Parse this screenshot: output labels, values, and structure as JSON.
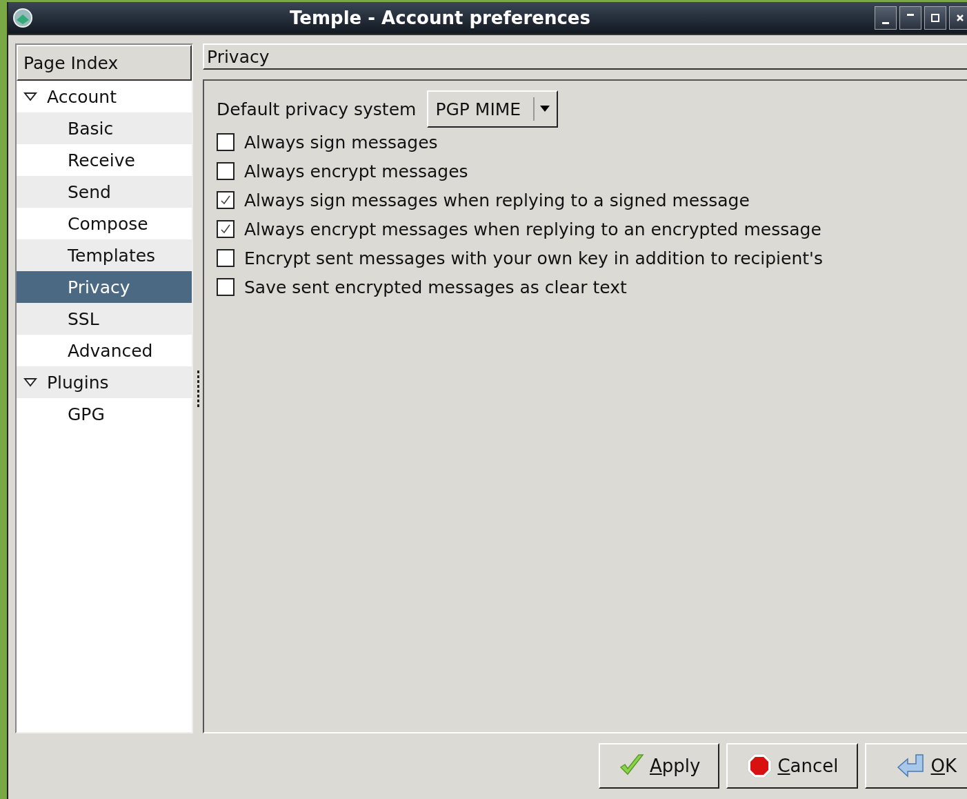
{
  "window": {
    "title": "Temple - Account preferences"
  },
  "sidebar": {
    "header": "Page Index",
    "items": [
      {
        "label": "Account",
        "expanded": true,
        "selected": false,
        "children": [
          {
            "label": "Basic",
            "selected": false
          },
          {
            "label": "Receive",
            "selected": false
          },
          {
            "label": "Send",
            "selected": false
          },
          {
            "label": "Compose",
            "selected": false
          },
          {
            "label": "Templates",
            "selected": false
          },
          {
            "label": "Privacy",
            "selected": true
          },
          {
            "label": "SSL",
            "selected": false
          },
          {
            "label": "Advanced",
            "selected": false
          }
        ]
      },
      {
        "label": "Plugins",
        "expanded": true,
        "selected": false,
        "children": [
          {
            "label": "GPG",
            "selected": false
          }
        ]
      }
    ]
  },
  "page": {
    "title": "Privacy",
    "privacy_system": {
      "label": "Default privacy system",
      "value": "PGP MIME"
    },
    "options": [
      {
        "label": "Always sign messages",
        "checked": false
      },
      {
        "label": "Always encrypt messages",
        "checked": false
      },
      {
        "label": "Always sign messages when replying to a signed message",
        "checked": true
      },
      {
        "label": "Always encrypt messages when replying to an encrypted message",
        "checked": true
      },
      {
        "label": "Encrypt sent messages with your own key in addition to recipient's",
        "checked": false
      },
      {
        "label": "Save sent encrypted messages as clear text",
        "checked": false
      }
    ]
  },
  "buttons": [
    {
      "label": "Apply",
      "kind": "apply"
    },
    {
      "label": "Cancel",
      "kind": "cancel"
    },
    {
      "label": "OK",
      "kind": "ok"
    }
  ]
}
